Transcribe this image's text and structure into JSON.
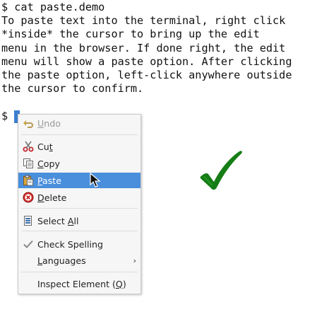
{
  "terminal": {
    "lines": [
      "$ cat paste.demo",
      "To paste text into the terminal, right click",
      "*inside* the cursor to bring up the edit",
      "menu in the browser. If done right, the edit",
      "menu will show a paste option. After clicking",
      "the paste option, left-click anywhere outside",
      "the cursor to confirm."
    ],
    "prompt": "$"
  },
  "context_menu": {
    "items": [
      {
        "label": "Undo",
        "icon": "undo-icon",
        "disabled": true
      },
      {
        "label": "Cut",
        "icon": "scissors-icon"
      },
      {
        "label": "Copy",
        "icon": "copy-icon"
      },
      {
        "label": "Paste",
        "icon": "clipboard-icon",
        "highlighted": true
      },
      {
        "label": "Delete",
        "icon": "delete-icon"
      },
      {
        "label": "Select All",
        "icon": "select-all-icon"
      },
      {
        "label": "Check Spelling",
        "icon": "checkmark-icon",
        "checked": true
      },
      {
        "label": "Languages",
        "has_submenu": true
      },
      {
        "label": "Inspect Element (Q)"
      }
    ]
  },
  "colors": {
    "highlight": "#4a8fdc",
    "cursor": "#3d7fd1",
    "check_green": "#148a14"
  }
}
